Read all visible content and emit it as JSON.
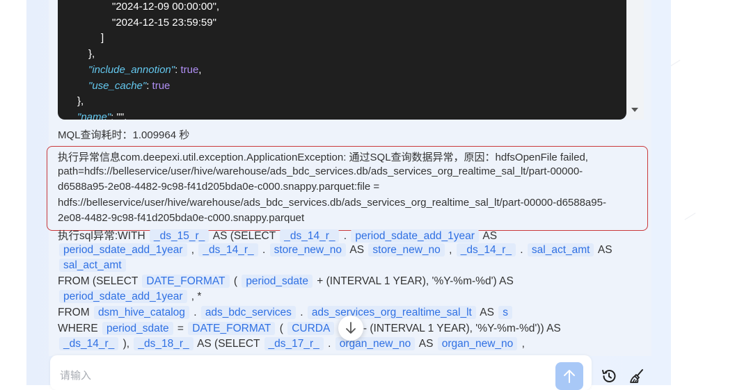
{
  "code_block": {
    "lines": [
      {
        "indent": 4,
        "parts": [
          {
            "t": "\"2024-12-09 00:00:00\",",
            "c": "p"
          }
        ]
      },
      {
        "indent": 4,
        "parts": [
          {
            "t": "\"2024-12-15 23:59:59\"",
            "c": "p"
          }
        ]
      },
      {
        "indent": 3,
        "parts": [
          {
            "t": "]",
            "c": "p"
          }
        ]
      },
      {
        "indent": 2,
        "parts": [
          {
            "t": "},",
            "c": "p"
          }
        ]
      },
      {
        "indent": 2,
        "parts": [
          {
            "t": "\"include_annotion\"",
            "c": "k"
          },
          {
            "t": ": ",
            "c": "p"
          },
          {
            "t": "true",
            "c": "v"
          },
          {
            "t": ",",
            "c": "p"
          }
        ]
      },
      {
        "indent": 2,
        "parts": [
          {
            "t": "\"use_cache\"",
            "c": "k"
          },
          {
            "t": ": ",
            "c": "p"
          },
          {
            "t": "true",
            "c": "v"
          }
        ]
      },
      {
        "indent": 1,
        "parts": [
          {
            "t": "},",
            "c": "p"
          }
        ]
      },
      {
        "indent": 1,
        "parts": [
          {
            "t": "\"name\"",
            "c": "k"
          },
          {
            "t": ": \"\",",
            "c": "p"
          }
        ]
      }
    ]
  },
  "timing": "MQL查询耗时：1.009964 秒",
  "error_lines": [
    "执行异常信息com.deepexi.util.exception.ApplicationException: 通过SQL查询数据异常，原因：hdfsOpenFile failed,",
    "path=hdfs://belleservice/user/hive/warehouse/ads_bdc_services.db/ads_services_org_realtime_sal_lt/part-00000-",
    "d6588a95-2e08-4482-9c98-f41d205bda0e-c000.snappy.parquet:file =",
    "hdfs://belleservice/user/hive/warehouse/ads_bdc_services.db/ads_services_org_realtime_sal_lt/part-00000-d6588a95-",
    "2e08-4482-9c98-f41d205bda0e-c000.snappy.parquet"
  ],
  "sql_lines": [
    [
      {
        "t": "执行sql异常:WITH "
      },
      {
        "t": "_ds_15_r_",
        "tok": true
      },
      {
        "t": " AS (SELECT "
      },
      {
        "t": "_ds_14_r_",
        "tok": true
      },
      {
        "t": " . "
      },
      {
        "t": "period_sdate_add_1year",
        "tok": true
      },
      {
        "t": " AS"
      }
    ],
    [
      {
        "t": "period_sdate_add_1year",
        "tok": true
      },
      {
        "t": " , "
      },
      {
        "t": "_ds_14_r_",
        "tok": true
      },
      {
        "t": " . "
      },
      {
        "t": "store_new_no",
        "tok": true
      },
      {
        "t": " AS "
      },
      {
        "t": "store_new_no",
        "tok": true
      },
      {
        "t": " , "
      },
      {
        "t": "_ds_14_r_",
        "tok": true
      },
      {
        "t": " . "
      },
      {
        "t": "sal_act_amt",
        "tok": true
      },
      {
        "t": " AS"
      }
    ],
    [
      {
        "t": "sal_act_amt",
        "tok": true
      }
    ],
    [
      {
        "t": "FROM (SELECT "
      },
      {
        "t": "DATE_FORMAT",
        "tok": true
      },
      {
        "t": " ( "
      },
      {
        "t": "period_sdate",
        "tok": true
      },
      {
        "t": " + (INTERVAL 1 YEAR), '%Y-%m-%d') AS"
      }
    ],
    [
      {
        "t": "period_sdate_add_1year",
        "tok": true
      },
      {
        "t": " , *"
      }
    ],
    [
      {
        "t": "FROM "
      },
      {
        "t": "dsm_hive_catalog",
        "tok": true
      },
      {
        "t": " . "
      },
      {
        "t": "ads_bdc_services",
        "tok": true
      },
      {
        "t": " . "
      },
      {
        "t": "ads_services_org_realtime_sal_lt",
        "tok": true
      },
      {
        "t": " AS "
      },
      {
        "t": "s",
        "tok": true
      }
    ],
    [
      {
        "t": "WHERE "
      },
      {
        "t": "period_sdate",
        "tok": true
      },
      {
        "t": " = "
      },
      {
        "t": "DATE_FORMAT",
        "tok": true
      },
      {
        "t": " ( "
      },
      {
        "t": "CURDA",
        "tok": true
      },
      {
        "t": "       ) - (INTERVAL 1 YEAR), '%Y-%m-%d')) AS"
      }
    ],
    [
      {
        "t": "_ds_14_r_",
        "tok": true
      },
      {
        "t": " ), "
      },
      {
        "t": "_ds_18_r_",
        "tok": true
      },
      {
        "t": " AS (SELECT "
      },
      {
        "t": "_ds_17_r_",
        "tok": true
      },
      {
        "t": " . "
      },
      {
        "t": "organ_new_no",
        "tok": true
      },
      {
        "t": " AS "
      },
      {
        "t": "organ_new_no",
        "tok": true
      },
      {
        "t": " ,"
      }
    ]
  ],
  "input": {
    "placeholder": "请输入",
    "value": ""
  },
  "icons": {
    "scroll_down": "arrow-down-icon",
    "send": "arrow-up-icon",
    "history": "history-clock-icon",
    "clear": "broom-icon"
  },
  "colors": {
    "code_bg": "#1f1f1f",
    "json_key": "#64c8ef",
    "json_bool": "#b08ff4",
    "token_bg": "#e1ebfb",
    "token_text": "#2f70e3",
    "error_border": "#c9383a",
    "send_button": "#a8c8f7"
  }
}
